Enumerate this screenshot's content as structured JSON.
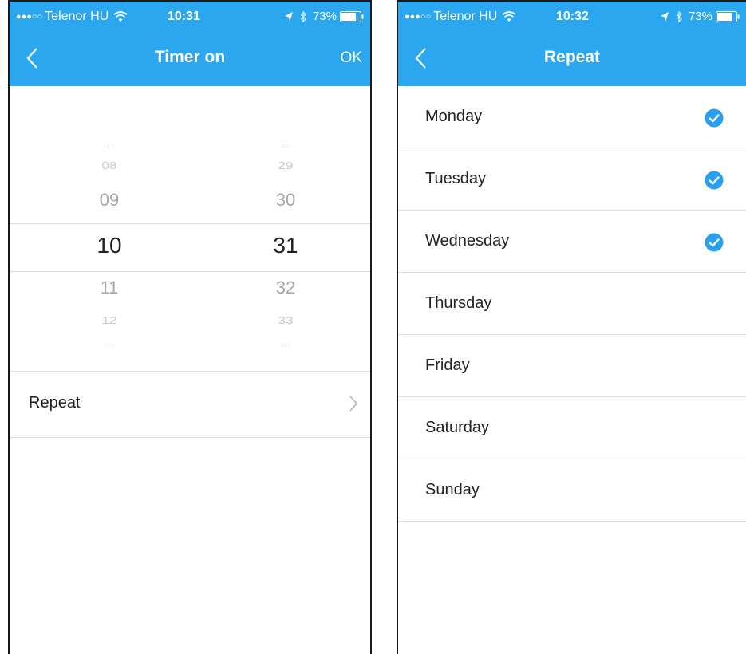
{
  "colors": {
    "accent": "#2aa7ee",
    "check": "#2a9ff0",
    "text": "#222222"
  },
  "left": {
    "status": {
      "signal_dots": "●●●○○",
      "carrier": "Telenor HU",
      "time": "10:31",
      "battery": "73%"
    },
    "nav": {
      "title": "Timer on",
      "ok_label": "OK"
    },
    "picker": {
      "hours": [
        "07",
        "08",
        "09",
        "10",
        "11",
        "12",
        "13"
      ],
      "minutes": [
        "28",
        "29",
        "30",
        "31",
        "32",
        "33",
        "34"
      ],
      "selected_hour": "10",
      "selected_minute": "31"
    },
    "repeat_label": "Repeat"
  },
  "right": {
    "status": {
      "signal_dots": "●●●○○",
      "carrier": "Telenor HU",
      "time": "10:32",
      "battery": "73%"
    },
    "nav": {
      "title": "Repeat"
    },
    "days": [
      {
        "label": "Monday",
        "checked": true
      },
      {
        "label": "Tuesday",
        "checked": true
      },
      {
        "label": "Wednesday",
        "checked": true
      },
      {
        "label": "Thursday",
        "checked": false
      },
      {
        "label": "Friday",
        "checked": false
      },
      {
        "label": "Saturday",
        "checked": false
      },
      {
        "label": "Sunday",
        "checked": false
      }
    ]
  }
}
